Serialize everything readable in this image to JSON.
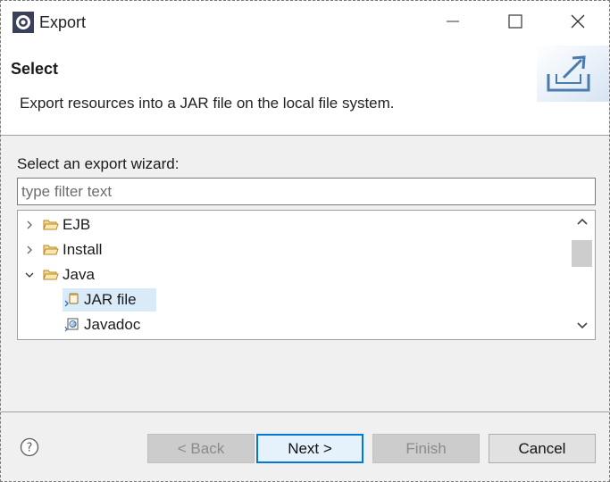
{
  "window": {
    "title": "Export",
    "icons": {
      "app": "eclipse-icon",
      "minimize": "minimize-icon",
      "maximize": "maximize-icon",
      "close": "close-icon"
    }
  },
  "banner": {
    "title": "Select",
    "description": "Export resources into a JAR file on the local file system.",
    "graphic": "export-wizard-icon"
  },
  "content": {
    "wizard_label": "Select an export wizard:",
    "filter_placeholder": "type filter text",
    "filter_value": ""
  },
  "tree": {
    "items": [
      {
        "label": "EJB",
        "expanded": false,
        "icon": "folder-icon"
      },
      {
        "label": "Install",
        "expanded": false,
        "icon": "folder-icon"
      },
      {
        "label": "Java",
        "expanded": true,
        "icon": "folder-icon"
      },
      {
        "label": "JAR file",
        "selected": true,
        "icon": "jar-file-icon"
      },
      {
        "label": "Javadoc",
        "icon": "javadoc-icon"
      }
    ]
  },
  "footer": {
    "help_icon": "help-icon",
    "back_label": "< Back",
    "next_label": "Next >",
    "finish_label": "Finish",
    "cancel_label": "Cancel"
  },
  "colors": {
    "accent": "#0078d7",
    "selection": "#d9ebf9",
    "banner_bg": "#ffffff",
    "dialog_bg": "#f0f0f0"
  }
}
